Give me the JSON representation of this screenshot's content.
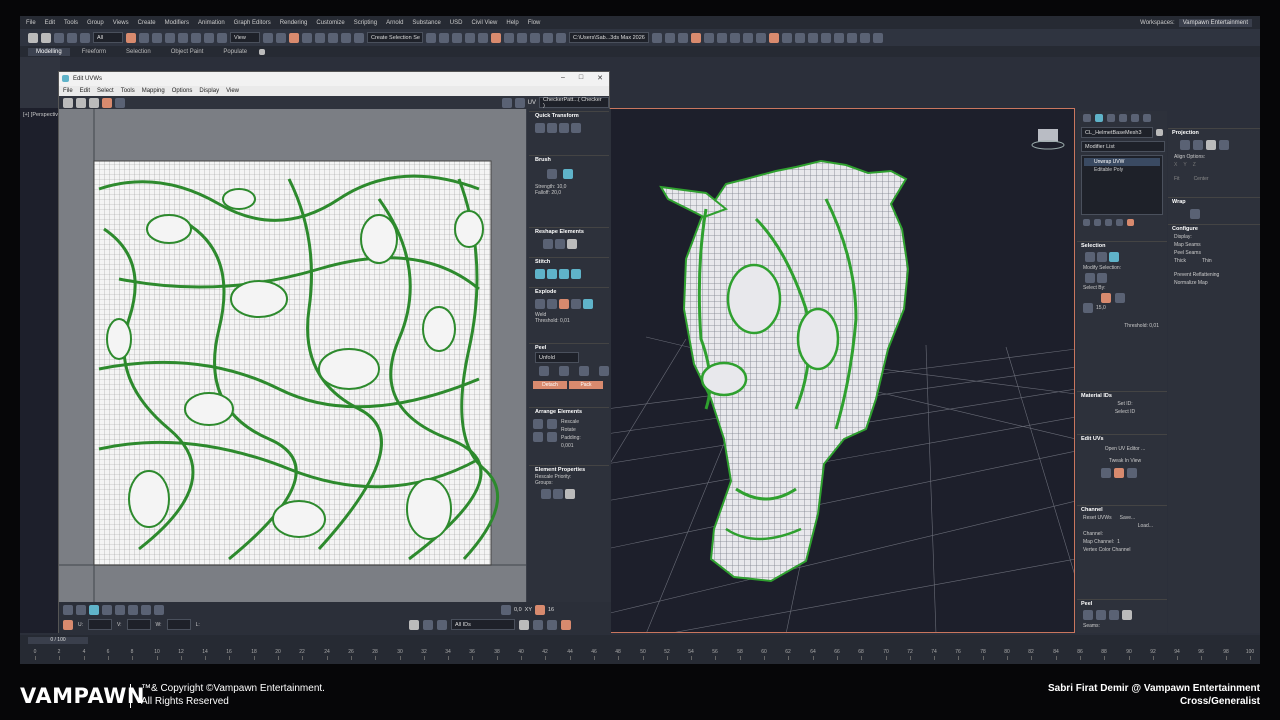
{
  "menu": [
    "File",
    "Edit",
    "Tools",
    "Group",
    "Views",
    "Create",
    "Modifiers",
    "Animation",
    "Graph Editors",
    "Rendering",
    "Customize",
    "Scripting",
    "Arnold",
    "Substance",
    "USD",
    "Civil View",
    "Help",
    "Flow"
  ],
  "workspaces_label": "Workspaces:",
  "workspace_value": "Vampawn Entertainment",
  "toolbar": {
    "all": "All",
    "view": "View",
    "selection_set": "Create Selection Se",
    "path": "C:\\Users\\Sab...3ds Max 2026"
  },
  "ribbon_tabs": [
    "Modelling",
    "Freeform",
    "Selection",
    "Object Paint",
    "Populate"
  ],
  "viewport_label": "[+] [Perspectiv",
  "uvw": {
    "title": "Edit UVWs",
    "menu": [
      "File",
      "Edit",
      "Select",
      "Tools",
      "Mapping",
      "Options",
      "Display",
      "View"
    ],
    "uv_label": "UV",
    "checker": "CheckerPatt...( Checker )",
    "quick_transform": "Quick Transform",
    "brush": "Brush",
    "strength_label": "Strength:",
    "strength": "10,0",
    "falloff_label": "Falloff:",
    "falloff": "20,0",
    "reshape": "Reshape Elements",
    "stitch": "Stitch",
    "explode": "Explode",
    "weld": "Weld",
    "threshold_label": "Threshold:",
    "threshold": "0,01",
    "peel": "Peel",
    "unfold": "Unfold",
    "detach": "Detach",
    "pack": "Pack",
    "arrange": "Arrange Elements",
    "rescale": "Rescale",
    "rotate": "Rotate",
    "padding_label": "Padding:",
    "padding": "0,001",
    "element_props": "Element Properties",
    "rescale_priority": "Rescale Priority:",
    "groups": "Groups:",
    "u_label": "U:",
    "v_label": "V:",
    "w_label": "W:",
    "l_label": "L:",
    "zoom": "0,0",
    "xy": "XY",
    "grid": "16",
    "all_ids": "All IDs"
  },
  "cmd": {
    "object_name": "CL_HelmetBaseMesh3",
    "modifier_list": "Modifier List",
    "stack": [
      "Unwrap UVW",
      "Editable Poly"
    ],
    "selection": "Selection",
    "modify_selection": "Modify Selection:",
    "select_by": "Select By:",
    "angle": "15,0",
    "threshold_label": "Threshold:",
    "threshold": "0,01",
    "material_ids": "Material IDs",
    "set_id": "Set ID:",
    "select_id": "Select ID",
    "edit_uvs": "Edit UVs",
    "open_uv_editor": "Open UV Editor ...",
    "tweak_in_view": "Tweak In View",
    "channel": "Channel",
    "reset_uvws": "Reset UVWs",
    "save": "Save...",
    "load": "Load...",
    "channel_label": "Channel:",
    "map_channel": "Map Channel:",
    "map_channel_value": "1",
    "vertex_color_channel": "Vertex Color Channel",
    "peel": "Peel",
    "seams": "Seams:"
  },
  "props": {
    "projection": "Projection",
    "align_options": "Align Options:",
    "align_axes": [
      "X",
      "Y",
      "Z"
    ],
    "fit": "Fit",
    "center": "Center",
    "wrap": "Wrap",
    "configure": "Configure",
    "display": "Display:",
    "map_seams": "Map Seams",
    "peel_seams": "Peel Seams",
    "thick": "Thick",
    "thin": "Thin",
    "prevent_reflattening": "Prevent Reflattening",
    "normalize_map": "Normalize Map"
  },
  "timeline": {
    "frame": "0 / 100",
    "ticks": [
      "0",
      "2",
      "4",
      "6",
      "8",
      "10",
      "12",
      "14",
      "16",
      "18",
      "20",
      "22",
      "24",
      "26",
      "28",
      "30",
      "32",
      "34",
      "36",
      "38",
      "40",
      "42",
      "44",
      "46",
      "48",
      "50",
      "52",
      "54",
      "56",
      "58",
      "60",
      "62",
      "64",
      "66",
      "68",
      "70",
      "72",
      "74",
      "76",
      "78",
      "80",
      "82",
      "84",
      "86",
      "88",
      "90",
      "92",
      "94",
      "96",
      "98",
      "100"
    ]
  },
  "footer": {
    "logo": "VAMPAWN",
    "copyright_line1": "™& Copyright ©Vampawn Entertainment.",
    "copyright_line2": "All Rights Reserved",
    "credit_line1": "Sabri Firat Demir @ Vampawn Entertainment",
    "credit_line2": "Cross/Generalist"
  },
  "colors": {
    "accent_orange": "#d88a6e",
    "accent_cyan": "#5fb3c9",
    "uv_green": "#3aa53a",
    "viewport_bg": "#1d1f2b"
  },
  "icons": [
    "undo-icon",
    "redo-icon",
    "link-icon",
    "select-icon",
    "move-icon",
    "rotate-icon",
    "scale-icon",
    "snap-icon",
    "render-icon",
    "checker-icon",
    "lock-icon",
    "zoom-icon",
    "pan-icon"
  ]
}
